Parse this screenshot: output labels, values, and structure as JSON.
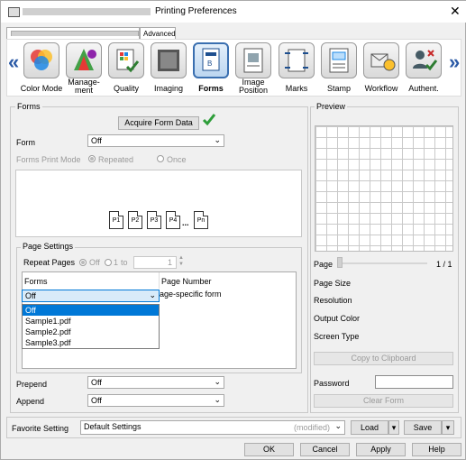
{
  "window": {
    "title": "Printing Preferences",
    "close": "✕"
  },
  "tabs": [
    {
      "label": ""
    },
    {
      "label": "Advanced"
    }
  ],
  "toolbar": {
    "items": [
      {
        "label": "Color Mode",
        "icon": "color-mode-icon"
      },
      {
        "label": "Manage-\nment",
        "icon": "management-icon"
      },
      {
        "label": "Quality",
        "icon": "quality-icon"
      },
      {
        "label": "Imaging",
        "icon": "imaging-icon"
      },
      {
        "label": "Forms",
        "icon": "forms-icon",
        "selected": true
      },
      {
        "label": "Image\nPosition",
        "icon": "image-position-icon"
      },
      {
        "label": "Marks",
        "icon": "marks-icon"
      },
      {
        "label": "Stamp",
        "icon": "stamp-icon"
      },
      {
        "label": "Workflow",
        "icon": "workflow-icon"
      },
      {
        "label": "Authent.",
        "icon": "authentication-icon"
      }
    ],
    "prev": "«",
    "next": "»"
  },
  "forms": {
    "section_title": "Forms",
    "acquire_button": "Acquire Form Data",
    "form_label": "Form",
    "form_value": "Off",
    "print_mode_label": "Forms Print Mode",
    "print_mode_repeated": "Repeated",
    "print_mode_once": "Once",
    "pages": [
      "P1",
      "P2",
      "P3",
      "P4",
      "...",
      "Pn"
    ]
  },
  "page_settings": {
    "title": "Page Settings",
    "repeat_pages_label": "Repeat Pages",
    "off": "Off",
    "from": "1",
    "to_label": "to",
    "to_value": "1",
    "col_forms": "Forms",
    "col_page_number": "Page Number",
    "row_forms_value": "Off",
    "row_page_value": "Page-specific form",
    "dropdown_options": [
      "Off",
      "Sample1.pdf",
      "Sample2.pdf",
      "Sample3.pdf"
    ],
    "prepend_label": "Prepend",
    "prepend_value": "Off",
    "append_label": "Append",
    "append_value": "Off"
  },
  "preview": {
    "title": "Preview",
    "page_label": "Page",
    "page_count": "1 / 1",
    "page_size": "Page Size",
    "resolution": "Resolution",
    "output_color": "Output Color",
    "screen_type": "Screen Type",
    "copy_button": "Copy to Clipboard",
    "password_label": "Password",
    "clear_button": "Clear Form"
  },
  "footer": {
    "favorite_label": "Favorite Setting",
    "favorite_value": "Default Settings",
    "modified": "(modified)",
    "load": "Load",
    "save": "Save",
    "ok": "OK",
    "cancel": "Cancel",
    "apply": "Apply",
    "help": "Help"
  }
}
